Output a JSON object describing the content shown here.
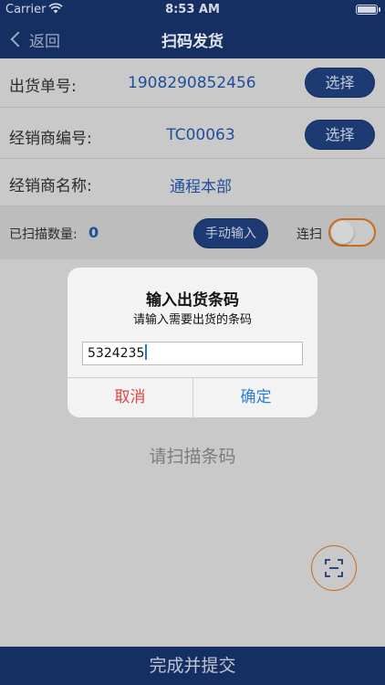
{
  "status_bar": {
    "carrier": "Carrier",
    "time": "8:53 AM"
  },
  "nav": {
    "back_label": "返回",
    "title": "扫码发货"
  },
  "form": {
    "shipment_no": {
      "label": "出货单号:",
      "value": "1908290852456",
      "button": "选择"
    },
    "dealer_code": {
      "label": "经销商编号:",
      "value": "TC00063",
      "button": "选择"
    },
    "dealer_name": {
      "label": "经销商名称:",
      "value": "通程本部"
    },
    "scanned": {
      "label": "已扫描数量:",
      "count": "0",
      "manual_button": "手动输入",
      "continuous_label": "连扫",
      "continuous_on": false
    }
  },
  "scan_prompt": "请扫描条码",
  "submit_label": "完成并提交",
  "dialog": {
    "title": "输入出货条码",
    "message": "请输入需要出货的条码",
    "input_value": "5324235",
    "cancel_label": "取消",
    "confirm_label": "确定"
  },
  "colors": {
    "nav_bg": "#162f63",
    "accent_blue": "#1e4f9a",
    "accent_orange": "#c76b1f",
    "cancel_red": "#e0453e",
    "confirm_blue": "#2d7cd6"
  }
}
